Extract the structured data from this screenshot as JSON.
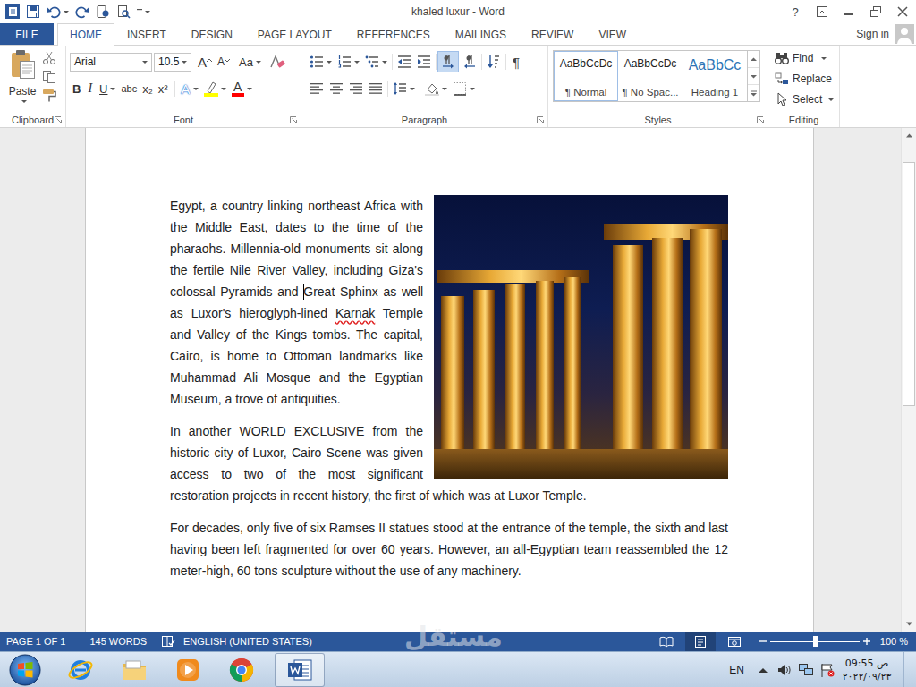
{
  "window": {
    "title": "khaled luxur - Word",
    "help": "?"
  },
  "file_tab": {
    "label": "FILE"
  },
  "ribbon_tabs": [
    {
      "label": "HOME",
      "selected": true
    },
    {
      "label": "INSERT",
      "selected": false
    },
    {
      "label": "DESIGN",
      "selected": false
    },
    {
      "label": "PAGE LAYOUT",
      "selected": false
    },
    {
      "label": "REFERENCES",
      "selected": false
    },
    {
      "label": "MAILINGS",
      "selected": false
    },
    {
      "label": "REVIEW",
      "selected": false
    },
    {
      "label": "VIEW",
      "selected": false
    }
  ],
  "account": {
    "label": "Sign in"
  },
  "clipboard": {
    "group": "Clipboard",
    "paste": "Paste"
  },
  "font": {
    "group": "Font",
    "name": "Arial",
    "size": "10.5",
    "grow": "A",
    "shrink": "A",
    "change_case": "Aa",
    "bold": "B",
    "italic": "I",
    "underline": "U",
    "strikethrough": "abc",
    "subscript": "x₂",
    "superscript": "x²",
    "text_effects": "A",
    "font_color": "A"
  },
  "paragraph": {
    "group": "Paragraph",
    "show_marks": "¶",
    "ltr_selected": true,
    "rtl_selected": false
  },
  "styles": {
    "group": "Styles",
    "items": [
      {
        "preview": "AaBbCcDc",
        "label": "¶ Normal",
        "selected": true,
        "kind": "body"
      },
      {
        "preview": "AaBbCcDc",
        "label": "¶ No Spac...",
        "selected": false,
        "kind": "body"
      },
      {
        "preview": "AaBbCc",
        "label": "Heading 1",
        "selected": false,
        "kind": "heading"
      }
    ]
  },
  "editing": {
    "group": "Editing",
    "find": "Find",
    "replace": "Replace",
    "select": "Select"
  },
  "document": {
    "paragraphs": [
      {
        "runs": [
          {
            "text": "Egypt, a country linking northeast Africa with the Middle East, dates to the time of the pharaohs. Millennia-old monuments sit along the fertile Nile River Valley, including Giza's colossal Pyramids and ",
            "misspelled": false,
            "caret": false
          },
          {
            "text": "Great Sphinx as well as Luxor's hieroglyph-lined ",
            "misspelled": false,
            "caret": true
          },
          {
            "text": "Karnak",
            "misspelled": true,
            "caret": false
          },
          {
            "text": " Temple and Valley of the Kings tombs. The capital, Cairo, is home to Ottoman landmarks like Muhammad Ali Mosque and the Egyptian Museum, a trove of antiquities.",
            "misspelled": false,
            "caret": false
          }
        ]
      },
      {
        "runs": [
          {
            "text": "In another WORLD EXCLUSIVE from the historic city of Luxor, Cairo Scene was given access to two of the most significant restoration projects in recent history, the first of which was at Luxor Temple.",
            "misspelled": false,
            "caret": false
          }
        ]
      },
      {
        "runs": [
          {
            "text": "For decades, only five of six Ramses II statues stood at the entrance of the temple, the sixth and last having been left fragmented for over 60 years. However, an all-Egyptian team reassembled the 12 meter-high, 60 tons sculpture without the use of any machinery.",
            "misspelled": false,
            "caret": false
          }
        ]
      }
    ]
  },
  "status_bar": {
    "page": "PAGE 1 OF 1",
    "words": "145 WORDS",
    "language": "ENGLISH (UNITED STATES)",
    "views": [
      {
        "selected": false
      },
      {
        "selected": true
      },
      {
        "selected": false
      }
    ],
    "zoom_level": 0.5,
    "zoom": "100 %"
  },
  "taskbar": {
    "apps": [
      {
        "selected": false
      },
      {
        "selected": false
      },
      {
        "selected": false
      },
      {
        "selected": false
      },
      {
        "selected": true
      }
    ],
    "language": "EN",
    "time": "09:55 ص",
    "date": "٢٠٢٢/٠٩/٢٣"
  },
  "watermark": {
    "text": "مستقل"
  }
}
